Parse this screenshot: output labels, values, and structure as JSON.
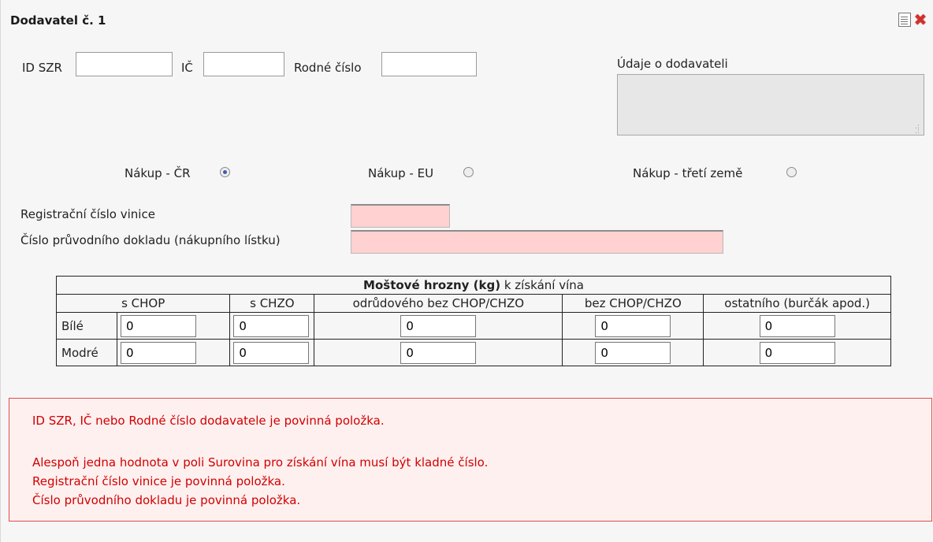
{
  "header": {
    "title": "Dodavatel č. 1",
    "icons": [
      "copy-document-icon",
      "delete-icon"
    ]
  },
  "ids": {
    "id_szr_label": "ID SZR",
    "ic_label": "IČ",
    "rodne_cislo_label": "Rodné číslo",
    "id_szr_value": "",
    "ic_value": "",
    "rodne_cislo_value": ""
  },
  "supplier_info": {
    "label": "Údaje o dodavateli",
    "value": ""
  },
  "purchase": {
    "options": [
      {
        "label": "Nákup - ČR",
        "checked": true
      },
      {
        "label": "Nákup - EU",
        "checked": false
      },
      {
        "label": "Nákup - třetí země",
        "checked": false
      }
    ]
  },
  "registration": {
    "vineyard_label": "Registrační číslo vinice",
    "document_label": "Číslo průvodního dokladu (nákupního lístku)",
    "vineyard_value": "",
    "document_value": ""
  },
  "grapes_table": {
    "title_bold": "Moštové hrozny (kg)",
    "title_rest": " k získání vína",
    "columns": [
      "s CHOP",
      "s CHZO",
      "odrůdového bez CHOP/CHZO",
      "bez CHOP/CHZO",
      "ostatního (burčák apod.)"
    ],
    "rows": [
      {
        "label": "Bílé",
        "values": [
          "0",
          "0",
          "0",
          "0",
          "0"
        ]
      },
      {
        "label": "Modré",
        "values": [
          "0",
          "0",
          "0",
          "0",
          "0"
        ]
      }
    ]
  },
  "errors": [
    "ID SZR, IČ nebo Rodné číslo dodavatele je povinná položka.",
    "Alespoň jedna hodnota v poli Surovina pro získání vína musí být kladné číslo.",
    "Registrační číslo vinice je povinná položka.",
    "Číslo průvodního dokladu je povinná položka."
  ],
  "colors": {
    "error_text": "#d10000",
    "error_border": "#e34a4a",
    "required_field_bg": "#ffd1d1"
  }
}
